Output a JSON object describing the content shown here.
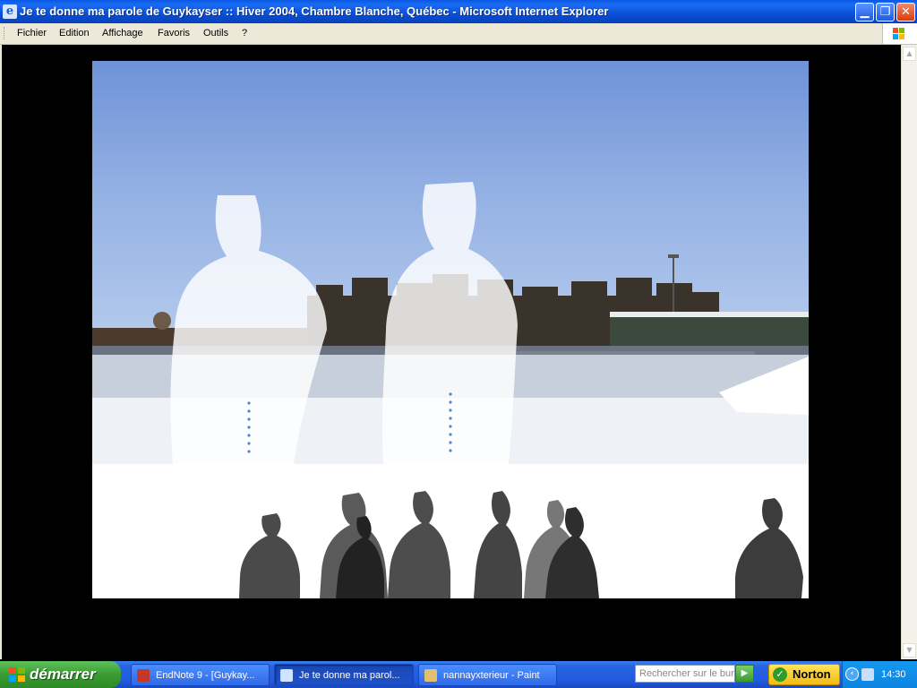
{
  "window": {
    "title": "Je te donne ma parole de Guykayser :: Hiver 2004, Chambre Blanche, Québec - Microsoft Internet Explorer",
    "minimize_glyph": "▁",
    "restore_glyph": "❐",
    "close_glyph": "✕"
  },
  "menu": {
    "items": [
      "Fichier",
      "Edition",
      "Affichage",
      "Favoris",
      "Outils",
      "?"
    ]
  },
  "scrollbar": {
    "up_glyph": "▲",
    "down_glyph": "▼"
  },
  "artwork": {
    "description_icon": "photo-collage",
    "sky_color": "#8aa9e2",
    "snow_color": "#eef1f6",
    "silhouette_ghost_color": "#ffffff",
    "silhouette_dark_color": "#3a3a3a"
  },
  "taskbar": {
    "start_label": "démarrer",
    "tasks": [
      {
        "label": "EndNote 9 - [Guykay...",
        "icon": "endnote-icon",
        "icon_color": "#c0392b"
      },
      {
        "label": "Je te donne ma parol...",
        "icon": "ie-icon",
        "icon_color": "#cfe3ff"
      },
      {
        "label": "nannayxterieur - Paint",
        "icon": "paint-icon",
        "icon_color": "#e0c070"
      }
    ],
    "search_placeholder": "Rechercher sur le bur",
    "search_go_glyph": "▶",
    "norton_label": "Norton",
    "norton_check": "✓",
    "tray_chevron": "‹",
    "clock": "14:30"
  }
}
